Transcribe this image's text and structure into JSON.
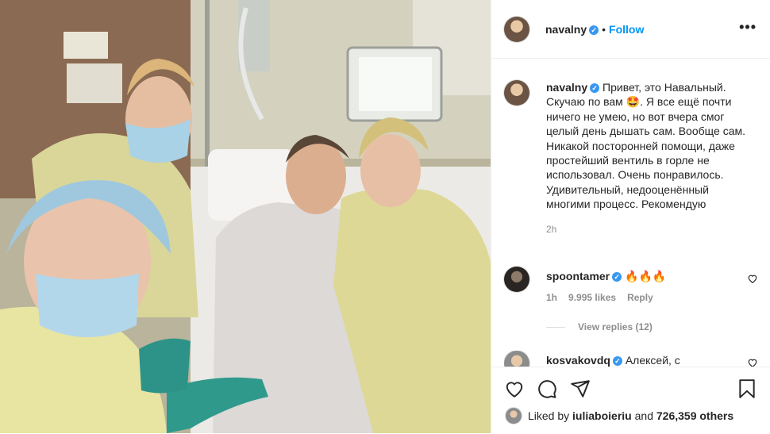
{
  "post": {
    "username": "navalny",
    "verified_mark": "✓",
    "follow_label": "Follow",
    "dot": "•",
    "more_label": "•••",
    "caption": "Привет, это Навальный. Скучаю по вам 🤩. Я все ещё почти ничего не умею, но вот вчера смог целый день дышать сам. Вообще сам. Никакой посторонней помощи, даже простейший вентиль в горле не использовал. Очень понравилось. Удивительный, недооценённый многими процесс. Рекомендую",
    "time_ago": "2h"
  },
  "comments": [
    {
      "username": "spoontamer",
      "text": "🔥🔥🔥",
      "time": "1h",
      "likes": "9.995 likes",
      "reply_label": "Reply",
      "view_replies": "View replies (12)"
    },
    {
      "username": "kosvakovdq",
      "text": "Алексей, с"
    }
  ],
  "likes_bar": {
    "liked_by_prefix": "Liked by",
    "liked_by_user": "iuliaboieriu",
    "and_label": "and",
    "others": "726,359 others"
  },
  "icons": {
    "heart": "heart-icon",
    "comment": "comment-icon",
    "share": "share-icon",
    "save": "bookmark-icon"
  },
  "colors": {
    "follow_blue": "#0095f6",
    "verified_blue": "#3897f0",
    "meta_gray": "#8e8e8e"
  }
}
